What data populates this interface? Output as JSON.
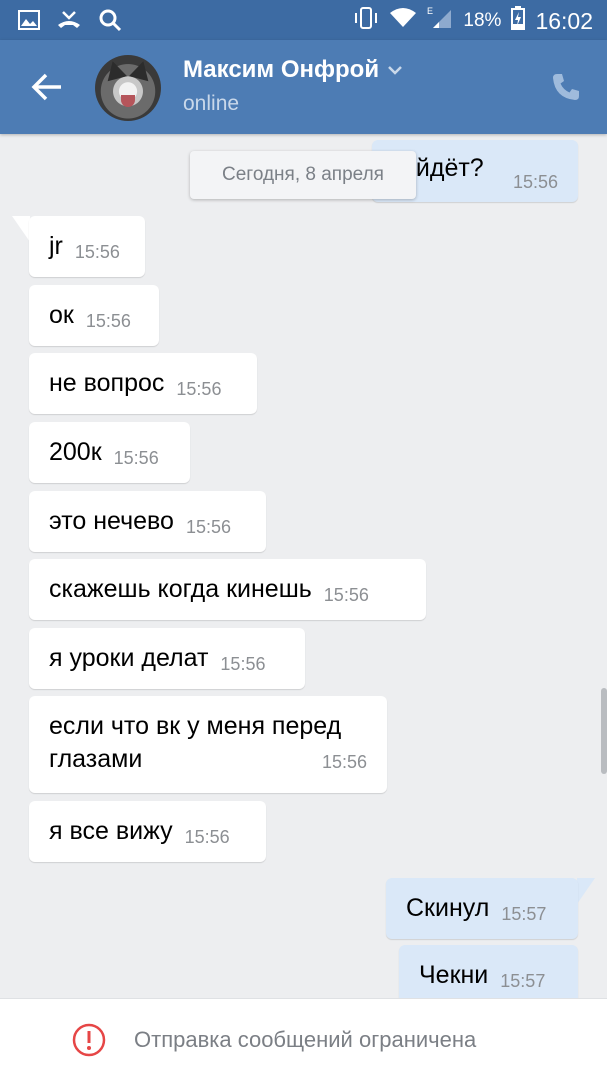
{
  "status_bar": {
    "battery": "18%",
    "time": "16:02",
    "network_type": "E"
  },
  "header": {
    "name": "Максим Онфрой",
    "status": "online"
  },
  "chat": {
    "date_label": "Сегодня, 8 апреля",
    "top_partial": {
      "text": "ойдёт?",
      "time": "15:56"
    },
    "messages": [
      {
        "text": "jr",
        "time": "15:56",
        "dir": "in"
      },
      {
        "text": "ок",
        "time": "15:56",
        "dir": "in"
      },
      {
        "text": "не вопрос",
        "time": "15:56",
        "dir": "in"
      },
      {
        "text": "200к",
        "time": "15:56",
        "dir": "in"
      },
      {
        "text": "это нечево",
        "time": "15:56",
        "dir": "in"
      },
      {
        "text": "скажешь когда кинешь",
        "time": "15:56",
        "dir": "in"
      },
      {
        "text": "я уроки делат",
        "time": "15:56",
        "dir": "in"
      },
      {
        "text": "если что вк у меня перед глазами",
        "time": "15:56",
        "dir": "in"
      },
      {
        "text": "я все вижу",
        "time": "15:56",
        "dir": "in"
      },
      {
        "text": "Скинул",
        "time": "15:57",
        "dir": "out"
      },
      {
        "text": "Чекни",
        "time": "15:57",
        "dir": "out"
      }
    ]
  },
  "footer": {
    "notice": "Отправка сообщений ограничена"
  },
  "colors": {
    "header": "#4d7cb4",
    "status_bar": "#3d6ba3",
    "outgoing_bubble": "#dae8f8",
    "background": "#edeef0"
  }
}
